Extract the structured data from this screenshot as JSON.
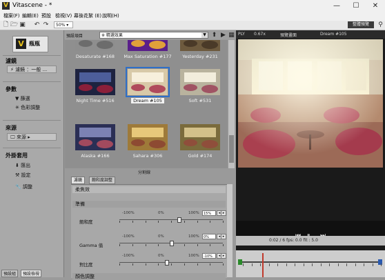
{
  "window": {
    "title": "Vitascene - *",
    "controls": {
      "minimize": "—",
      "maximize": "☐",
      "close": "✕"
    }
  },
  "menu": [
    {
      "label": "檔案(F)"
    },
    {
      "label": "編輯(E)"
    },
    {
      "label": "預設"
    },
    {
      "label": "檢視(V)"
    },
    {
      "label": "幕後花絮 (E)"
    },
    {
      "label": "說明(H)"
    }
  ],
  "toolbar": {
    "zoom": "50%",
    "view_toggle": "整體預覽"
  },
  "left": {
    "logo": "瓶瓶",
    "sections": [
      {
        "title": "濾鏡",
        "button": "⚡ 濾鏡 ：一般 ..."
      },
      {
        "title": "參數",
        "items": [
          "▼ 篩選",
          "✳ 色彩調整"
        ]
      },
      {
        "title": "來源",
        "button": "🖵 來源 ▸"
      },
      {
        "title": "外掛套用",
        "items": [
          "⬇ 匯出",
          "⚒ 設定",
          "🔧 調整"
        ]
      }
    ],
    "tabs": [
      "預設組",
      "預設檢視"
    ]
  },
  "presets": {
    "label": "預設項目",
    "combo": "※ 精選效果",
    "grid": [
      {
        "caption": "Desaturate #168",
        "style": "desat"
      },
      {
        "caption": "Max Saturation #177",
        "style": "maxsat"
      },
      {
        "caption": "Yesterday #231",
        "style": "yesterday"
      },
      {
        "caption": "Night Time #516",
        "style": "night"
      },
      {
        "caption": "Dream #105",
        "style": "dream",
        "selected": true
      },
      {
        "caption": "Soft #531",
        "style": "soft"
      },
      {
        "caption": "Alaska #166",
        "style": "alaska"
      },
      {
        "caption": "Sahara #306",
        "style": "sahara"
      },
      {
        "caption": "Gold #174",
        "style": "gold"
      }
    ],
    "split_label": "分割線"
  },
  "adjust": {
    "tabs": [
      "濾鏡",
      "飽和度調整"
    ],
    "header": "柔焦效",
    "subheader": "準備",
    "sliders": [
      {
        "label": "飽和度",
        "min": "-100%",
        "mid": "0%",
        "max": "100%",
        "value_text": "15%",
        "value": 15
      },
      {
        "label": "Gamma 值",
        "min": "-100%",
        "mid": "0%",
        "max": "100%",
        "value_text": "0%",
        "value": 0
      },
      {
        "label": "對比度",
        "min": "-100%",
        "mid": "0%",
        "max": "100%",
        "value_text": "-10%",
        "value": -10
      }
    ],
    "next_header": "顏色調整"
  },
  "viewer": {
    "bar": {
      "left": "PLY",
      "zoom": "0.67x",
      "mode": "預覽畫面",
      "preset": "Dream #105"
    },
    "timecode": "0:02 / 6    fps: 0.0    fit : 5.0"
  }
}
